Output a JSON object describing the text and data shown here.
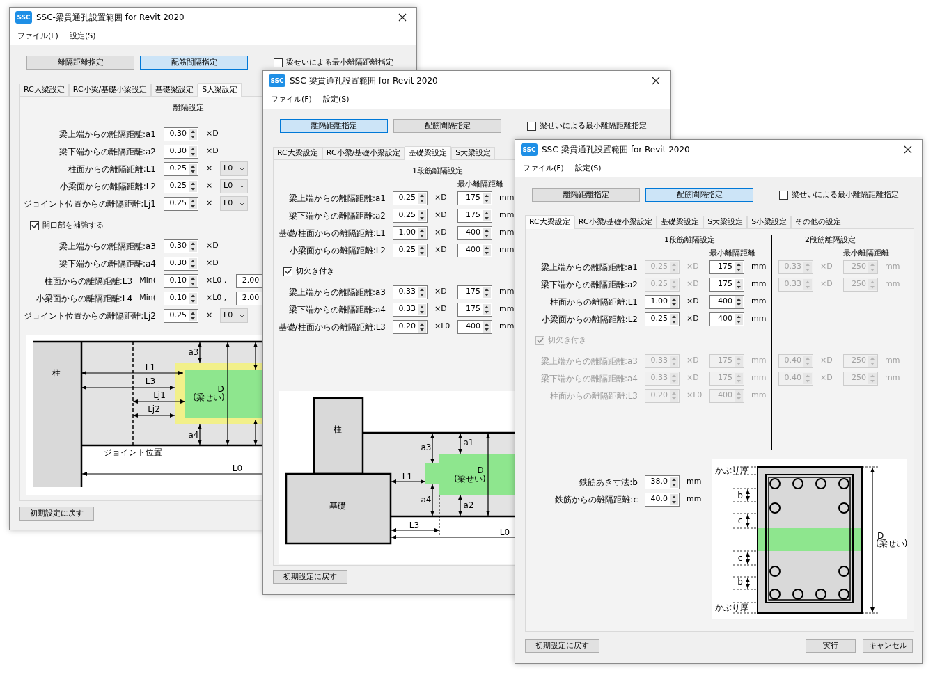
{
  "windows": [
    {
      "title": "SSC-梁貫通孔設置範囲 for Revit 2020",
      "app_icon": "SSC",
      "menu": [
        "ファイル(F)",
        "設定(S)"
      ],
      "mode_buttons": [
        {
          "label": "離隔距離指定",
          "selected": false
        },
        {
          "label": "配筋間隔指定",
          "selected": true
        }
      ],
      "depth_checkbox": {
        "label": "梁せいによる最小離隔距離指定",
        "checked": false
      },
      "tabs": [
        {
          "label": "RC大梁設定",
          "selected": false
        },
        {
          "label": "RC小梁/基礎小梁設定",
          "selected": false
        },
        {
          "label": "基礎梁設定",
          "selected": false
        },
        {
          "label": "S大梁設定",
          "selected": true
        }
      ],
      "panel": {
        "kind": "s_beam",
        "heading": "離隔設定",
        "rows": [
          {
            "label": "梁上端からの離隔距離:a1",
            "cells": [
              {
                "kind": "spin",
                "value": "0.30"
              },
              {
                "kind": "unit",
                "text": "×D"
              }
            ]
          },
          {
            "label": "梁下端からの離隔距離:a2",
            "cells": [
              {
                "kind": "spin",
                "value": "0.30"
              },
              {
                "kind": "unit",
                "text": "×D"
              }
            ]
          },
          {
            "label": "柱面からの離隔距離:L1",
            "cells": [
              {
                "kind": "spin",
                "value": "0.25"
              },
              {
                "kind": "unit",
                "text": "×"
              },
              {
                "kind": "select",
                "value": "L0"
              }
            ]
          },
          {
            "label": "小梁面からの離隔距離:L2",
            "cells": [
              {
                "kind": "spin",
                "value": "0.25"
              },
              {
                "kind": "unit",
                "text": "×"
              },
              {
                "kind": "select",
                "value": "L0"
              }
            ]
          },
          {
            "label": "ジョイント位置からの離隔距離:Lj1",
            "cells": [
              {
                "kind": "spin",
                "value": "0.25"
              },
              {
                "kind": "unit",
                "text": "×"
              },
              {
                "kind": "select",
                "value": "L0"
              }
            ]
          }
        ],
        "checkbox": {
          "label": "開口部を補強する",
          "checked": true
        },
        "rows2": [
          {
            "label": "梁上端からの離隔距離:a3",
            "cells": [
              {
                "kind": "spin",
                "value": "0.30"
              },
              {
                "kind": "unit",
                "text": "×D"
              }
            ]
          },
          {
            "label": "梁下端からの離隔距離:a4",
            "cells": [
              {
                "kind": "spin",
                "value": "0.30"
              },
              {
                "kind": "unit",
                "text": "×D"
              }
            ]
          },
          {
            "label": "柱面からの離隔距離:L3",
            "prefix": "Min(",
            "cells": [
              {
                "kind": "spin",
                "value": "0.10"
              },
              {
                "kind": "unit",
                "text": "×L0 ,"
              },
              {
                "kind": "input",
                "value": "2.00"
              }
            ]
          },
          {
            "label": "小梁面からの離隔距離:L4",
            "prefix": "Min(",
            "cells": [
              {
                "kind": "spin",
                "value": "0.10"
              },
              {
                "kind": "unit",
                "text": "×L0 ,"
              },
              {
                "kind": "input",
                "value": "2.00"
              }
            ]
          },
          {
            "label": "ジョイント位置からの離隔距離:Lj2",
            "cells": [
              {
                "kind": "spin",
                "value": "0.25"
              },
              {
                "kind": "unit",
                "text": "×"
              },
              {
                "kind": "select",
                "value": "L0"
              }
            ]
          }
        ],
        "diagram": {
          "kind": "s_beam",
          "labels": [
            "柱",
            "L1",
            "L3",
            "Lj1",
            "Lj2",
            "a3",
            "a4",
            "D",
            "(梁せい)",
            "ジョイント位置",
            "L0"
          ]
        }
      },
      "reset_button": "初期設定に戻す"
    },
    {
      "title": "SSC-梁貫通孔設置範囲 for Revit 2020",
      "app_icon": "SSC",
      "menu": [
        "ファイル(F)",
        "設定(S)"
      ],
      "mode_buttons": [
        {
          "label": "離隔距離指定",
          "selected": true
        },
        {
          "label": "配筋間隔指定",
          "selected": false
        }
      ],
      "depth_checkbox": {
        "label": "梁せいによる最小離隔距離指定",
        "checked": false
      },
      "tabs": [
        {
          "label": "RC大梁設定",
          "selected": false
        },
        {
          "label": "RC小梁/基礎小梁設定",
          "selected": false
        },
        {
          "label": "基礎梁設定",
          "selected": true
        },
        {
          "label": "S大梁設定",
          "selected": false
        }
      ],
      "panel": {
        "kind": "foundation_beam",
        "heading": "1段筋離隔設定",
        "subheading": "最小離隔距離",
        "rows": [
          {
            "label": "梁上端からの離隔距離:a1",
            "cells": [
              {
                "kind": "spin",
                "value": "0.25"
              },
              {
                "kind": "unit",
                "text": "×D"
              },
              {
                "kind": "spin",
                "value": "175"
              },
              {
                "kind": "unit",
                "text": "mm"
              }
            ]
          },
          {
            "label": "梁下端からの離隔距離:a2",
            "cells": [
              {
                "kind": "spin",
                "value": "0.25"
              },
              {
                "kind": "unit",
                "text": "×D"
              },
              {
                "kind": "spin",
                "value": "175"
              },
              {
                "kind": "unit",
                "text": "mm"
              }
            ]
          },
          {
            "label": "基礎/柱面からの離隔距離:L1",
            "cells": [
              {
                "kind": "spin",
                "value": "1.00"
              },
              {
                "kind": "unit",
                "text": "×D"
              },
              {
                "kind": "spin",
                "value": "400"
              },
              {
                "kind": "unit",
                "text": "mm"
              }
            ]
          },
          {
            "label": "小梁面からの離隔距離:L2",
            "cells": [
              {
                "kind": "spin",
                "value": "0.25"
              },
              {
                "kind": "unit",
                "text": "×D"
              },
              {
                "kind": "spin",
                "value": "400"
              },
              {
                "kind": "unit",
                "text": "mm"
              }
            ]
          }
        ],
        "checkbox": {
          "label": "切欠き付き",
          "checked": true
        },
        "rows2": [
          {
            "label": "梁上端からの離隔距離:a3",
            "cells": [
              {
                "kind": "spin",
                "value": "0.33"
              },
              {
                "kind": "unit",
                "text": "×D"
              },
              {
                "kind": "spin",
                "value": "175"
              },
              {
                "kind": "unit",
                "text": "mm"
              }
            ]
          },
          {
            "label": "梁下端からの離隔距離:a4",
            "cells": [
              {
                "kind": "spin",
                "value": "0.33"
              },
              {
                "kind": "unit",
                "text": "×D"
              },
              {
                "kind": "spin",
                "value": "175"
              },
              {
                "kind": "unit",
                "text": "mm"
              }
            ]
          },
          {
            "label": "基礎/柱面からの離隔距離:L3",
            "cells": [
              {
                "kind": "spin",
                "value": "0.20"
              },
              {
                "kind": "unit",
                "text": "×L0"
              },
              {
                "kind": "spin",
                "value": "400"
              },
              {
                "kind": "unit",
                "text": "mm"
              }
            ]
          }
        ],
        "diagram": {
          "kind": "foundation_beam",
          "labels": [
            "柱",
            "基礎",
            "a3",
            "a1",
            "L1",
            "D",
            "(梁せい)",
            "a4",
            "a2",
            "L3",
            "L0"
          ]
        }
      },
      "reset_button": "初期設定に戻す"
    },
    {
      "title": "SSC-梁貫通孔設置範囲 for Revit 2020",
      "app_icon": "SSC",
      "menu": [
        "ファイル(F)",
        "設定(S)"
      ],
      "mode_buttons": [
        {
          "label": "離隔距離指定",
          "selected": false
        },
        {
          "label": "配筋間隔指定",
          "selected": true
        }
      ],
      "depth_checkbox": {
        "label": "梁せいによる最小離隔距離指定",
        "checked": false
      },
      "tabs": [
        {
          "label": "RC大梁設定",
          "selected": true
        },
        {
          "label": "RC小梁/基礎小梁設定",
          "selected": false
        },
        {
          "label": "基礎梁設定",
          "selected": false
        },
        {
          "label": "S大梁設定",
          "selected": false
        },
        {
          "label": "S小梁設定",
          "selected": false
        },
        {
          "label": "その他の設定",
          "selected": false
        }
      ],
      "panel": {
        "kind": "rc_beam",
        "heading": "1段筋離隔設定",
        "subheading": "最小離隔距離",
        "heading2": "2段筋離隔設定",
        "subheading2": "最小離隔距離",
        "rows": [
          {
            "label": "梁上端からの離隔距離:a1",
            "disabled": false,
            "cells": [
              {
                "kind": "spin",
                "value": "0.25",
                "disabled": true
              },
              {
                "kind": "unit",
                "text": "×D",
                "disabled": true
              },
              {
                "kind": "spin",
                "value": "175",
                "disabled": false
              },
              {
                "kind": "unit",
                "text": "mm",
                "disabled": false
              }
            ],
            "cells2": [
              {
                "kind": "spin",
                "value": "0.33",
                "disabled": true
              },
              {
                "kind": "unit",
                "text": "×D",
                "disabled": true
              },
              {
                "kind": "spin",
                "value": "250",
                "disabled": true
              },
              {
                "kind": "unit",
                "text": "mm",
                "disabled": true
              }
            ]
          },
          {
            "label": "梁下端からの離隔距離:a2",
            "disabled": false,
            "cells": [
              {
                "kind": "spin",
                "value": "0.25",
                "disabled": true
              },
              {
                "kind": "unit",
                "text": "×D",
                "disabled": true
              },
              {
                "kind": "spin",
                "value": "175",
                "disabled": false
              },
              {
                "kind": "unit",
                "text": "mm",
                "disabled": false
              }
            ],
            "cells2": [
              {
                "kind": "spin",
                "value": "0.33",
                "disabled": true
              },
              {
                "kind": "unit",
                "text": "×D",
                "disabled": true
              },
              {
                "kind": "spin",
                "value": "250",
                "disabled": true
              },
              {
                "kind": "unit",
                "text": "mm",
                "disabled": true
              }
            ]
          },
          {
            "label": "柱面からの離隔距離:L1",
            "disabled": false,
            "cells": [
              {
                "kind": "spin",
                "value": "1.00",
                "disabled": false
              },
              {
                "kind": "unit",
                "text": "×D",
                "disabled": false
              },
              {
                "kind": "spin",
                "value": "400",
                "disabled": false
              },
              {
                "kind": "unit",
                "text": "mm",
                "disabled": false
              }
            ]
          },
          {
            "label": "小梁面からの離隔距離:L2",
            "disabled": false,
            "cells": [
              {
                "kind": "spin",
                "value": "0.25",
                "disabled": false
              },
              {
                "kind": "unit",
                "text": "×D",
                "disabled": false
              },
              {
                "kind": "spin",
                "value": "400",
                "disabled": false
              },
              {
                "kind": "unit",
                "text": "mm",
                "disabled": false
              }
            ]
          }
        ],
        "checkbox": {
          "label": "切欠き付き",
          "checked": true,
          "disabled": true
        },
        "rows2": [
          {
            "label": "梁上端からの離隔距離:a3",
            "disabled": true,
            "cells": [
              {
                "kind": "spin",
                "value": "0.33",
                "disabled": true
              },
              {
                "kind": "unit",
                "text": "×D",
                "disabled": true
              },
              {
                "kind": "spin",
                "value": "175",
                "disabled": true
              },
              {
                "kind": "unit",
                "text": "mm",
                "disabled": true
              }
            ],
            "cells2": [
              {
                "kind": "spin",
                "value": "0.40",
                "disabled": true
              },
              {
                "kind": "unit",
                "text": "×D",
                "disabled": true
              },
              {
                "kind": "spin",
                "value": "250",
                "disabled": true
              },
              {
                "kind": "unit",
                "text": "mm",
                "disabled": true
              }
            ]
          },
          {
            "label": "梁下端からの離隔距離:a4",
            "disabled": true,
            "cells": [
              {
                "kind": "spin",
                "value": "0.33",
                "disabled": true
              },
              {
                "kind": "unit",
                "text": "×D",
                "disabled": true
              },
              {
                "kind": "spin",
                "value": "175",
                "disabled": true
              },
              {
                "kind": "unit",
                "text": "mm",
                "disabled": true
              }
            ],
            "cells2": [
              {
                "kind": "spin",
                "value": "0.40",
                "disabled": true
              },
              {
                "kind": "unit",
                "text": "×D",
                "disabled": true
              },
              {
                "kind": "spin",
                "value": "250",
                "disabled": true
              },
              {
                "kind": "unit",
                "text": "mm",
                "disabled": true
              }
            ]
          },
          {
            "label": "柱面からの離隔距離:L3",
            "disabled": true,
            "cells": [
              {
                "kind": "spin",
                "value": "0.20",
                "disabled": true
              },
              {
                "kind": "unit",
                "text": "×L0",
                "disabled": true
              },
              {
                "kind": "spin",
                "value": "400",
                "disabled": true
              },
              {
                "kind": "unit",
                "text": "mm",
                "disabled": true
              }
            ]
          }
        ],
        "lower_rows": [
          {
            "label": "鉄筋あき寸法:b",
            "cells": [
              {
                "kind": "spin",
                "value": "38.0"
              },
              {
                "kind": "unit",
                "text": "mm"
              }
            ]
          },
          {
            "label": "鉄筋からの離隔距離:c",
            "cells": [
              {
                "kind": "spin",
                "value": "40.0"
              },
              {
                "kind": "unit",
                "text": "mm"
              }
            ]
          }
        ],
        "diagram": {
          "kind": "rebar_section",
          "labels": [
            "かぶり厚",
            "b",
            "c",
            "c",
            "b",
            "かぶり厚",
            "D",
            "(梁せい)"
          ]
        }
      },
      "reset_button": "初期設定に戻す",
      "action_buttons": [
        "実行",
        "キャンセル"
      ]
    }
  ]
}
